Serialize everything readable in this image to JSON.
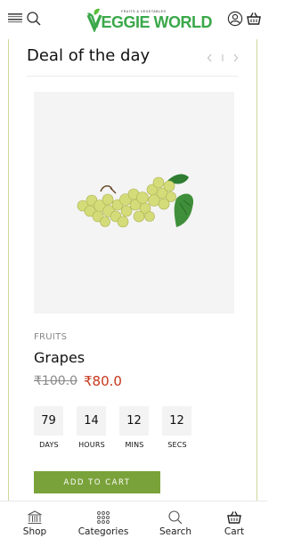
{
  "header": {
    "logo_main": "VEGGIE WORLD",
    "logo_tagline": "FRUITS & VEGETABLES",
    "icons": [
      "menu-icon",
      "search-icon",
      "user-icon",
      "cart-icon"
    ]
  },
  "deal": {
    "title": "Deal of the day",
    "product": {
      "category": "FRUITS",
      "name": "Grapes",
      "price_old": "₹100.0",
      "price_new": "₹80.0"
    },
    "countdown": [
      {
        "value": "79",
        "label": "DAYS"
      },
      {
        "value": "14",
        "label": "HOURS"
      },
      {
        "value": "12",
        "label": "MINS"
      },
      {
        "value": "12",
        "label": "SECS"
      }
    ],
    "add_to_cart": "ADD TO CART"
  },
  "colors": {
    "brand_green": "#7aa23a",
    "sale_red": "#c6361c",
    "frame_border": "#cdd89c"
  },
  "bottom_nav": [
    {
      "label": "Shop",
      "icon": "shop-icon"
    },
    {
      "label": "Categories",
      "icon": "grid-icon"
    },
    {
      "label": "Search",
      "icon": "search-icon"
    },
    {
      "label": "Cart",
      "icon": "cart-icon"
    }
  ]
}
